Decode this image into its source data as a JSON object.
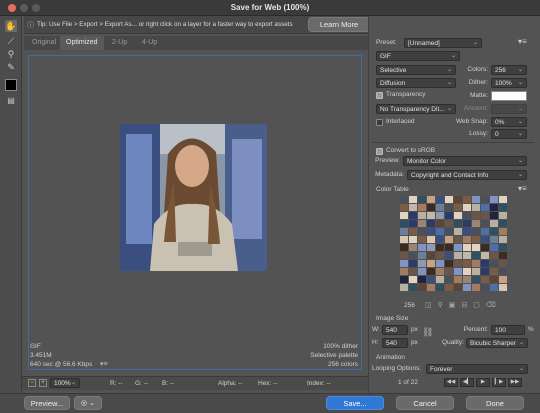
{
  "window": {
    "title": "Save for Web (100%)"
  },
  "tip": {
    "text": "Tip: Use File > Export > Export As... or right click on a layer for a faster way to export assets",
    "learn_more": "Learn More"
  },
  "tabs": [
    "Original",
    "Optimized",
    "2-Up",
    "4-Up"
  ],
  "info_left": {
    "format": "GIF",
    "size": "3.451M",
    "time": "640 sec @ 56.6 Kbps"
  },
  "info_right": {
    "dither": "100% dither",
    "palette": "Selective palette",
    "colors": "256 colors"
  },
  "statusbar": {
    "zoom": "100%",
    "r": "R: --",
    "g": "G: --",
    "b": "B: --",
    "alpha": "Alpha: --",
    "hex": "Hex: --",
    "index": "Index: --"
  },
  "panel": {
    "preset_label": "Preset:",
    "preset_value": "[Unnamed]",
    "format": "GIF",
    "reduction": "Selective",
    "colors_label": "Colors:",
    "colors_value": "256",
    "dither_algo": "Diffusion",
    "dither_label": "Dither:",
    "dither_value": "100%",
    "transparency_label": "Transparency",
    "matte_label": "Matte:",
    "transparency_dither": "No Transparency Dit...",
    "amount_label": "Amount:",
    "interlaced_label": "Interlaced",
    "websnap_label": "Web Snap:",
    "websnap_value": "0%",
    "lossy_label": "Lossy:",
    "lossy_value": "0",
    "convert_label": "Convert to sRGB",
    "preview_label": "Preview:",
    "preview_value": "Monitor Color",
    "metadata_label": "Metadata:",
    "metadata_value": "Copyright and Contact Info",
    "color_table_label": "Color Table",
    "color_count": "256",
    "image_size_label": "Image Size",
    "w_label": "W:",
    "w_value": "540",
    "h_label": "H:",
    "h_value": "540",
    "px": "px",
    "percent_label": "Percent:",
    "percent_value": "100",
    "percent_sign": "%",
    "quality_label": "Quality:",
    "quality_value": "Bicubic Sharper",
    "animation_label": "Animation",
    "looping_label": "Looping Options:",
    "looping_value": "Forever",
    "frame_counter": "1 of 22"
  },
  "buttons": {
    "preview": "Preview...",
    "save": "Save...",
    "cancel": "Cancel",
    "done": "Done"
  },
  "colors": {
    "accent": "#2f78d4",
    "panel": "#535353",
    "canvas_border": "#3b6ea8"
  },
  "icons": [
    "hand-icon",
    "slice-select-icon",
    "zoom-icon",
    "eyedropper-icon",
    "eyedropper-color-swatch",
    "toggle-slices-icon",
    "panel-menu-icon",
    "link-icon",
    "first-frame-icon",
    "prev-frame-icon",
    "play-icon",
    "next-frame-icon",
    "last-frame-icon"
  ]
}
